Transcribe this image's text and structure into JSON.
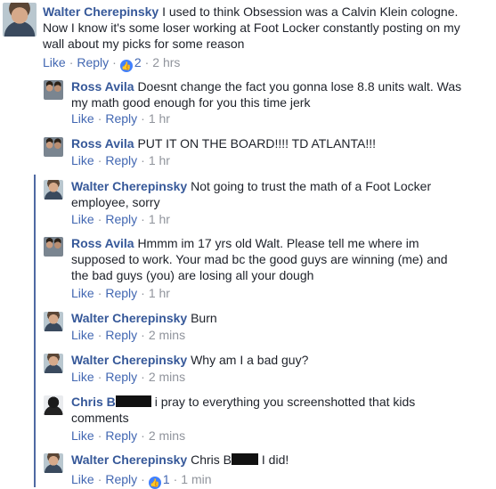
{
  "actions": {
    "like": "Like",
    "reply": "Reply",
    "sep": "·"
  },
  "comments": [
    {
      "author": "Walter Cherepinsky",
      "text": "I used to think Obsession was a Calvin Klein cologne. Now I know it's some loser working at Foot Locker constantly posting on my wall about my picks for some reason",
      "likes": "2",
      "time": "2 hrs"
    },
    {
      "author": "Ross Avila",
      "text": "Doesnt change the fact you gonna lose 8.8 units walt. Was my math good enough for you this time jerk",
      "time": "1 hr"
    },
    {
      "author": "Ross Avila",
      "text": "PUT IT ON THE BOARD!!!! TD ATLANTA!!!",
      "time": "1 hr"
    },
    {
      "author": "Walter Cherepinsky",
      "text": "Not going to trust the math of a Foot Locker employee, sorry",
      "time": "1 hr"
    },
    {
      "author": "Ross Avila",
      "text": "Hmmm im 17 yrs old Walt. Please tell me where im supposed to work. Your mad bc the good guys are winning (me) and the bad guys (you) are losing all your dough",
      "time": "1 hr"
    },
    {
      "author": "Walter Cherepinsky",
      "text": "Burn",
      "time": "2 mins"
    },
    {
      "author": "Walter Cherepinsky",
      "text": "Why am I a bad guy?",
      "time": "2 mins"
    },
    {
      "author": "Chris B",
      "text": "i pray to everything you screenshotted that kids comments",
      "time": "2 mins"
    },
    {
      "author": "Walter Cherepinsky",
      "mention": "Chris B",
      "text": "I did!",
      "likes": "1",
      "time": "1 min"
    }
  ],
  "icons": {
    "like_badge": "thumbs-up-icon"
  },
  "colors": {
    "name": "#365899",
    "link": "#4267b2",
    "meta": "#90949c",
    "thread_line": "#4e69a2",
    "like_badge": "#4080ff"
  }
}
